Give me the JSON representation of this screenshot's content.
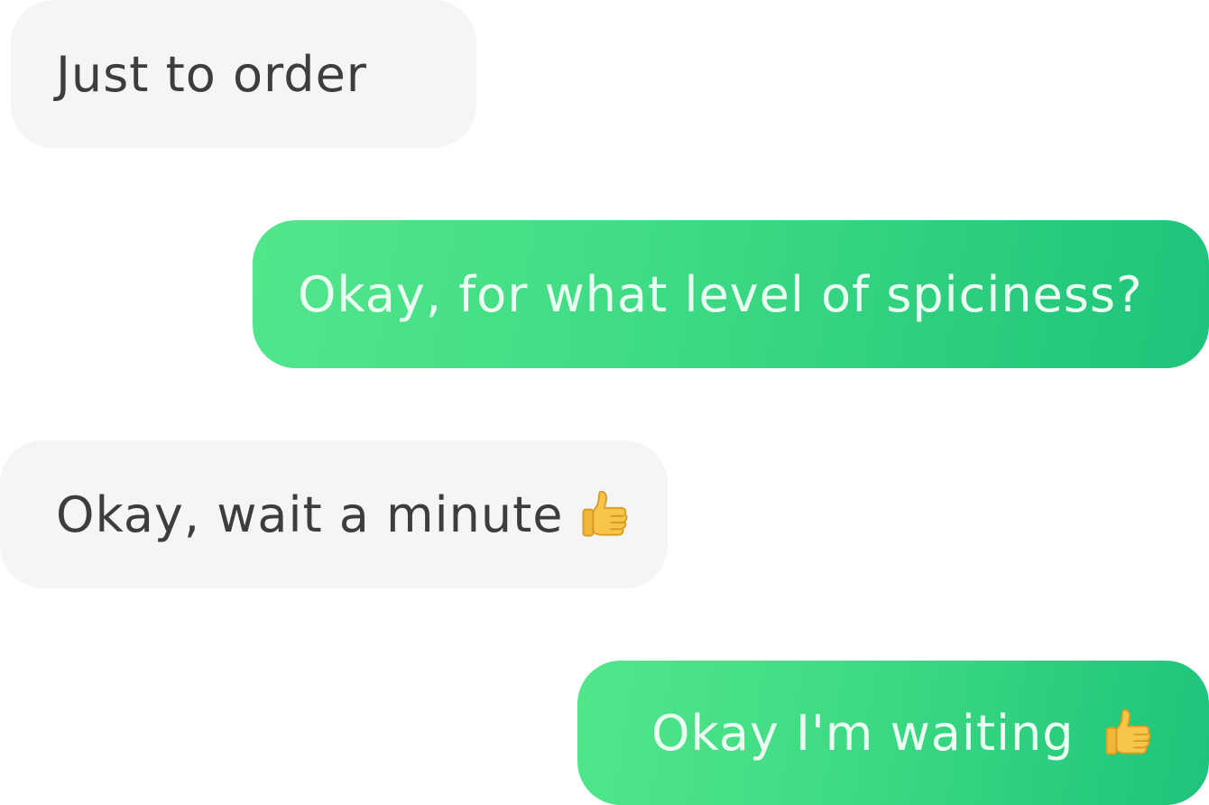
{
  "messages": [
    {
      "side": "incoming",
      "text": "Just to order"
    },
    {
      "side": "outgoing",
      "text": "Okay, for what level of spiciness?"
    },
    {
      "side": "incoming",
      "text": "Okay, wait a minute",
      "icon": "thumbs-up-icon"
    },
    {
      "side": "outgoing",
      "text": "Okay I'm waiting",
      "icon": "thumbs-up-icon"
    }
  ],
  "colors": {
    "incoming_bg": "#f5f5f5",
    "incoming_text": "#3d3d3d",
    "outgoing_gradient_start": "#52e68b",
    "outgoing_gradient_end": "#1dc47a",
    "outgoing_text": "#ecfff3"
  }
}
